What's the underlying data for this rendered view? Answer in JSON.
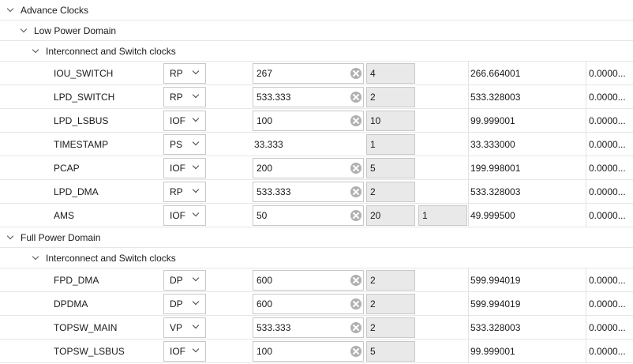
{
  "tree": {
    "advance_clocks": "Advance Clocks",
    "low_power_domain": "Low Power Domain",
    "low_interconnect": "Interconnect and Switch clocks",
    "full_power_domain": "Full Power Domain",
    "full_interconnect": "Interconnect and Switch clocks"
  },
  "low_power_clocks": [
    {
      "name": "IOU_SWITCH",
      "source": "RP",
      "requested": "267",
      "editable": true,
      "div0": "4",
      "div1": "",
      "actual": "266.664001",
      "error": "0.0000..."
    },
    {
      "name": "LPD_SWITCH",
      "source": "RP",
      "requested": "533.333",
      "editable": true,
      "div0": "2",
      "div1": "",
      "actual": "533.328003",
      "error": "0.0000..."
    },
    {
      "name": "LPD_LSBUS",
      "source": "IOF",
      "requested": "100",
      "editable": true,
      "div0": "10",
      "div1": "",
      "actual": "99.999001",
      "error": "0.0000..."
    },
    {
      "name": "TIMESTAMP",
      "source": "PS",
      "requested": "33.333",
      "editable": false,
      "div0": "1",
      "div1": "",
      "actual": "33.333000",
      "error": "0.0000..."
    },
    {
      "name": "PCAP",
      "source": "IOF",
      "requested": "200",
      "editable": true,
      "div0": "5",
      "div1": "",
      "actual": "199.998001",
      "error": "0.0000..."
    },
    {
      "name": "LPD_DMA",
      "source": "RP",
      "requested": "533.333",
      "editable": true,
      "div0": "2",
      "div1": "",
      "actual": "533.328003",
      "error": "0.0000..."
    },
    {
      "name": "AMS",
      "source": "IOF",
      "requested": "50",
      "editable": true,
      "div0": "20",
      "div1": "1",
      "actual": "49.999500",
      "error": "0.0000..."
    }
  ],
  "full_power_clocks": [
    {
      "name": "FPD_DMA",
      "source": "DP",
      "requested": "600",
      "editable": true,
      "div0": "2",
      "div1": "",
      "actual": "599.994019",
      "error": "0.0000..."
    },
    {
      "name": "DPDMA",
      "source": "DP",
      "requested": "600",
      "editable": true,
      "div0": "2",
      "div1": "",
      "actual": "599.994019",
      "error": "0.0000..."
    },
    {
      "name": "TOPSW_MAIN",
      "source": "VP",
      "requested": "533.333",
      "editable": true,
      "div0": "2",
      "div1": "",
      "actual": "533.328003",
      "error": "0.0000..."
    },
    {
      "name": "TOPSW_LSBUS",
      "source": "IOF",
      "requested": "100",
      "editable": true,
      "div0": "5",
      "div1": "",
      "actual": "99.999001",
      "error": "0.0000..."
    }
  ]
}
